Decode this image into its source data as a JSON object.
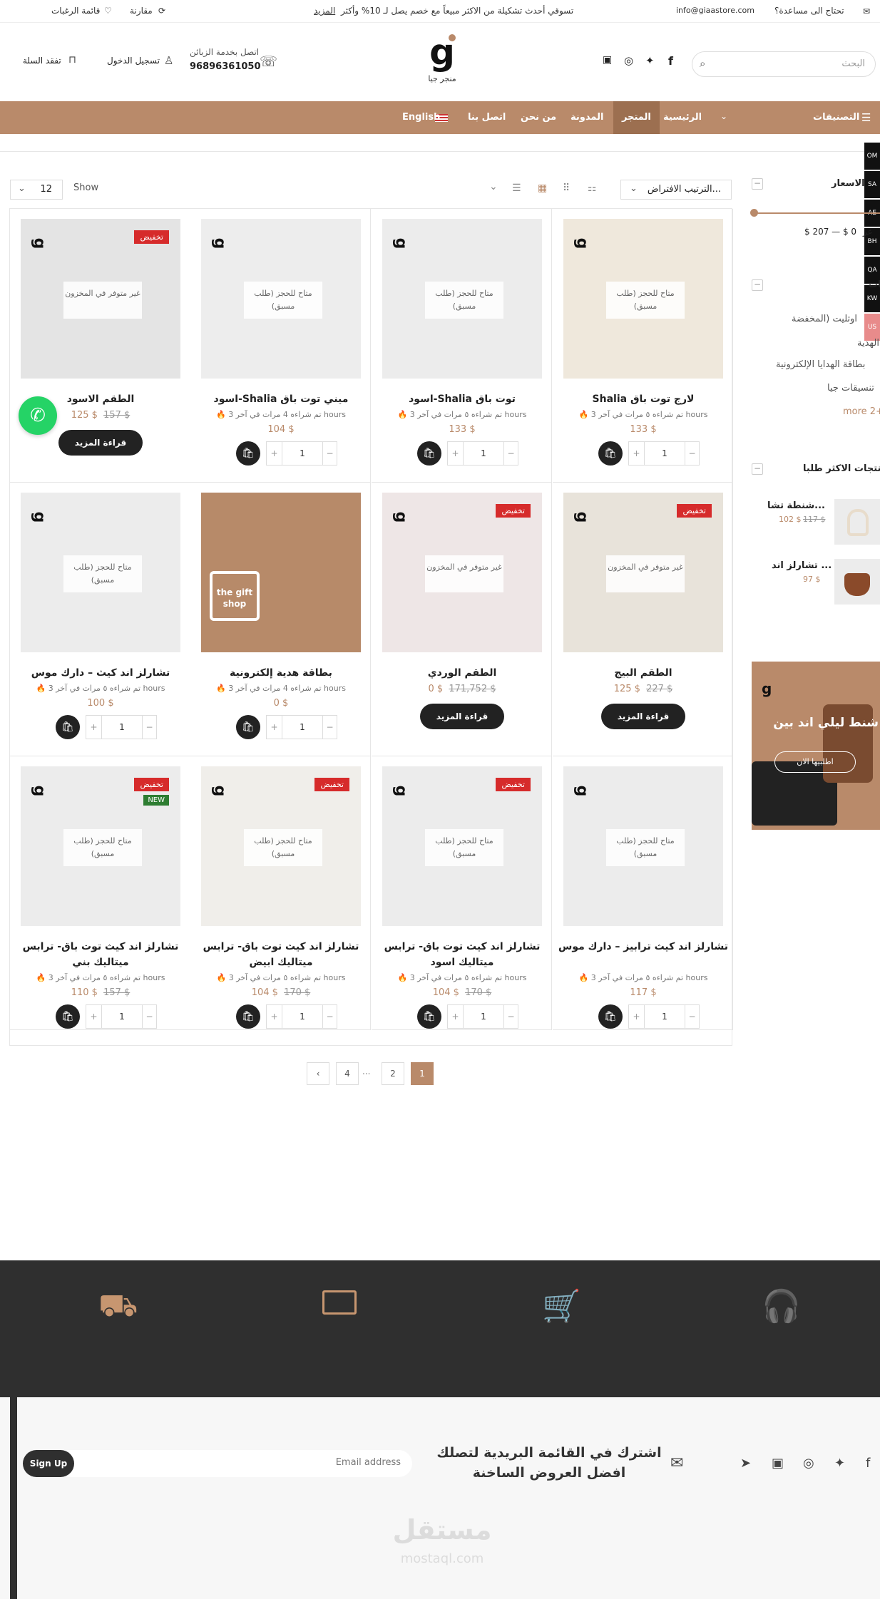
{
  "topbar": {
    "help": "تحتاج الى مساعدة؟",
    "email": "info@giaastore.com",
    "promo": "تسوقي أحدث تشكيلة من الاكثر مبيعاً مع خصم يصل لـ 10% وأكثر",
    "promo_link": "المزيد",
    "compare": "مقارنة",
    "wishlist": "قائمة الرغبات"
  },
  "header": {
    "search_placeholder": "البحث",
    "logo_text": "منجر جيا",
    "support_label": "اتصل بخدمة الزبائن",
    "support_phone": "96896361050",
    "login": "تسجيل الدخول",
    "cart": "تفقد السلة"
  },
  "nav": {
    "categories": "التصنيفات",
    "items": [
      "الرئيسية",
      "المتجر",
      "المدونة",
      "من نحن",
      "اتصل بنا",
      "English"
    ]
  },
  "currencies": [
    "OM",
    "SA",
    "AE",
    "BH",
    "QA",
    "KW",
    "US"
  ],
  "toolbar": {
    "sort": "الترتيب الافتراض...",
    "show_label": "Show",
    "show_value": "12"
  },
  "sidebar": {
    "price_title": "الاسعار",
    "price_range": "$ 207 — $ 0",
    "price_prefix": "عر",
    "categories_title": "تصنيفات",
    "categories": [
      "اوتليت (المخفضة",
      "الهدية",
      "بطاقة الهدايا الإلكترونية",
      "تنسيقات جيا"
    ],
    "more": "more 2+",
    "top_title": "المنتجات الاكثر طلبا",
    "top_products": [
      {
        "name": "شنطة تشا...",
        "price": "102 $",
        "old": "117 $"
      },
      {
        "name": "تشارلز اند ...",
        "price": "97 $",
        "old": ""
      }
    ],
    "banner_title": "شنط ليلي اند بين",
    "banner_button": "اطلبيها الان"
  },
  "labels": {
    "sale": "تخفيض",
    "new": "NEW",
    "preorder": "متاح للحجز (طلب مسبق)",
    "out_of_stock": "غير متوفر في المخزون",
    "read_more": "قراءة المزيد"
  },
  "products": [
    {
      "title": "Shalia لارج توت باق",
      "meta": "تم شراءه ٥ مرات في آخر 3 hours",
      "price": "133 $",
      "old": "",
      "state": "preorder",
      "sale": false,
      "new": false,
      "action": "qty",
      "color": "#efe8dc"
    },
    {
      "title": "اسود-Shalia توت باق",
      "meta": "تم شراءه ٥ مرات في آخر 3 hours",
      "price": "133 $",
      "old": "",
      "state": "preorder",
      "sale": false,
      "new": false,
      "action": "qty",
      "color": "#ececec"
    },
    {
      "title": "اسود-Shalia ميني توت باق",
      "meta": "تم شراءه 4 مرات في آخر 3 hours",
      "price": "104 $",
      "old": "",
      "state": "preorder",
      "sale": false,
      "new": false,
      "action": "qty",
      "color": "#ededed"
    },
    {
      "title": "الطقم الاسود",
      "meta": "",
      "price": "125 $",
      "old": "157 $",
      "state": "out",
      "sale": true,
      "new": false,
      "action": "more",
      "color": "#e4e4e4"
    },
    {
      "title": "الطقم البيج",
      "meta": "",
      "price": "125 $",
      "old": "227 $",
      "state": "out",
      "sale": true,
      "new": false,
      "action": "more",
      "color": "#e8e3da"
    },
    {
      "title": "الطقم الوردي",
      "meta": "",
      "price": "0 $",
      "old": "171,752 $",
      "state": "out",
      "sale": true,
      "new": false,
      "action": "more",
      "color": "#eee6e6"
    },
    {
      "title": "بطاقة هدية إلكترونية",
      "meta": "تم شراءه 4 مرات في آخر 3 hours",
      "price": "0 $",
      "old": "",
      "state": "",
      "sale": false,
      "new": false,
      "action": "qty",
      "color": "#b78a69"
    },
    {
      "title": "تشارلز اند كيث – دارك موس",
      "meta": "تم شراءه ٥ مرات في آخر 3 hours",
      "price": "100 $",
      "old": "",
      "state": "preorder",
      "sale": false,
      "new": false,
      "action": "qty",
      "color": "#ececec"
    },
    {
      "title": "تشارلز اند كيث ترابيز – دارك موس",
      "meta": "تم شراءه ٥ مرات في آخر 3 hours",
      "price": "117 $",
      "old": "",
      "state": "preorder",
      "sale": false,
      "new": false,
      "action": "qty",
      "color": "#ececec"
    },
    {
      "title": "تشارلز اند كيث توت باق- ترابس ميتاليك اسود",
      "meta": "تم شراءه ٥ مرات في آخر 3 hours",
      "price": "104 $",
      "old": "170 $",
      "state": "preorder",
      "sale": true,
      "new": false,
      "action": "qty",
      "color": "#ececec"
    },
    {
      "title": "تشارلز اند كيث توت باق- ترابس ميتاليك ابيض",
      "meta": "تم شراءه ٥ مرات في آخر 3 hours",
      "price": "104 $",
      "old": "170 $",
      "state": "preorder",
      "sale": true,
      "new": false,
      "action": "qty",
      "color": "#f0eeea"
    },
    {
      "title": "تشارلز اند كيث توت باق- ترابس ميتاليك بني",
      "meta": "تم شراءه ٥ مرات في آخر 3 hours",
      "price": "110 $",
      "old": "157 $",
      "state": "preorder",
      "sale": true,
      "new": true,
      "action": "qty",
      "color": "#ececec"
    }
  ],
  "pagination": [
    "1",
    "2",
    "...",
    "4"
  ],
  "footer": {
    "newsletter_title": "اشترك في القائمة البريدية لتصلك افضل العروض الساخنة",
    "email_placeholder": "Email address",
    "signup": "Sign Up",
    "watermark": "مستقل",
    "watermark_url": "mostaql.com"
  }
}
